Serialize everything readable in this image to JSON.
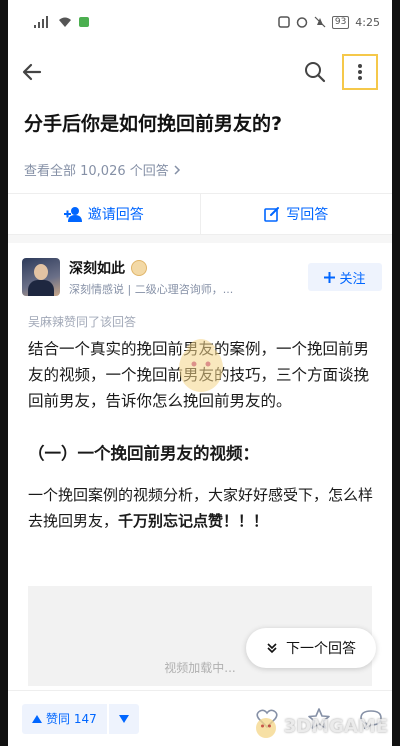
{
  "status_bar": {
    "time": "4:25",
    "battery": "93"
  },
  "question": {
    "title": "分手后你是如何挽回前男友的?",
    "view_all": "查看全部 10,026 个回答"
  },
  "actions": {
    "invite": "邀请回答",
    "write": "写回答"
  },
  "answer": {
    "author_name": "深刻如此",
    "author_desc": "深刻情感说 | 二级心理咨询师，...",
    "follow_label": "关注",
    "upvoted_note": "吴麻辣赞同了该回答",
    "paragraph1": "结合一个真实的挽回前男友的案例，一个挽回前男友的视频，一个挽回前男友的技巧，三个方面谈挽回前男友，告诉你怎么挽回前男友的。",
    "section_heading": "（一）一个挽回前男友的视频：",
    "paragraph2_plain": "一个挽回案例的视频分析，大家好好感受下，怎么样去挽回男友，",
    "paragraph2_bold": "千万别忘记点赞！！！",
    "video_loading": "视频加载中...",
    "next_answer": "下一个回答"
  },
  "bottom_bar": {
    "upvote_label": "赞同 147"
  },
  "watermark": {
    "text": "3DMGAME"
  },
  "colors": {
    "accent": "#0066ff",
    "accent_bg": "#eef3fd",
    "muted": "#8590a6"
  }
}
